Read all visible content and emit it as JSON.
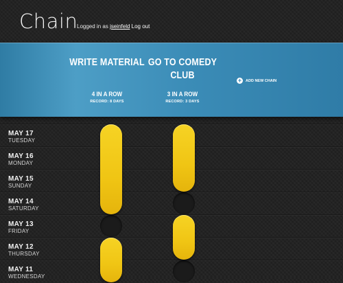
{
  "header": {
    "app_title": "Chain",
    "logged_in_prefix": "Logged in as",
    "username": "jseinfeld",
    "logout_label": "Log out"
  },
  "chains": [
    {
      "title": "Write Material",
      "streak": "4 IN A ROW",
      "record": "RECORD: 8 DAYS"
    },
    {
      "title": "Go to Comedy Club",
      "streak": "3 IN A ROW",
      "record": "RECORD: 3 DAYS"
    }
  ],
  "add_chain_label": "ADD NEW CHAIN",
  "days": [
    {
      "date": "MAY 17",
      "weekday": "TUESDAY"
    },
    {
      "date": "MAY 16",
      "weekday": "MONDAY"
    },
    {
      "date": "MAY 15",
      "weekday": "SUNDAY"
    },
    {
      "date": "MAY 14",
      "weekday": "SATURDAY"
    },
    {
      "date": "MAY 13",
      "weekday": "FRIDAY"
    },
    {
      "date": "MAY 12",
      "weekday": "THURSDAY"
    },
    {
      "date": "MAY 11",
      "weekday": "WEDNESDAY"
    }
  ],
  "completion": {
    "write_material": [
      true,
      true,
      true,
      true,
      false,
      true,
      true
    ],
    "go_to_comedy_club": [
      true,
      true,
      true,
      false,
      true,
      true,
      false
    ]
  },
  "colors": {
    "banner_blue": "#3b8cb7",
    "streak_yellow": "#f0c514",
    "background": "#232323"
  },
  "icons": {
    "add_chain": "plus-circle-icon"
  }
}
